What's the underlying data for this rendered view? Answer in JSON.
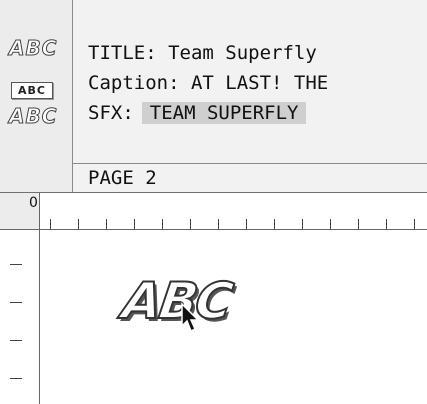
{
  "styles_palette": {
    "items": [
      {
        "label": "ABC",
        "kind": "sfx"
      },
      {
        "label": "ABC",
        "kind": "caption"
      },
      {
        "label": "ABC",
        "kind": "sfx"
      }
    ]
  },
  "script": {
    "lines": [
      {
        "text": "TITLE: Team Superfly"
      },
      {
        "text": "Caption: AT LAST! THE"
      },
      {
        "prefix": "SFX:",
        "value": "TEAM SUPERFLY"
      }
    ],
    "page_label": "PAGE 2"
  },
  "ruler": {
    "origin": "0"
  },
  "canvas": {
    "sfx_text": "ABC"
  },
  "colors": {
    "panel_bg": "#f2f2f2",
    "sfx_highlight": "#cfcfcf"
  }
}
